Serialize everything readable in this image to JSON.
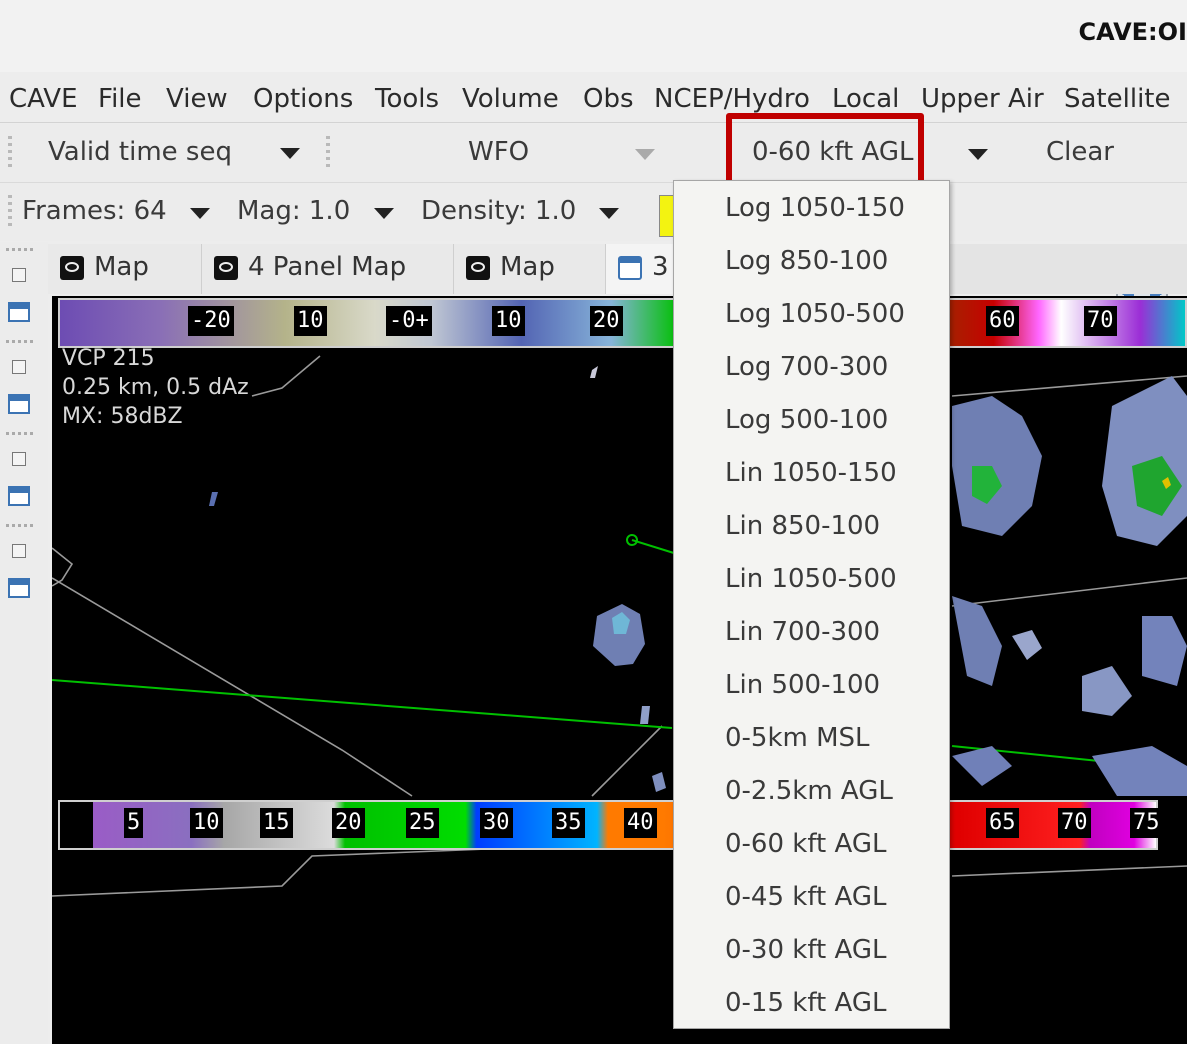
{
  "window": {
    "title": "CAVE:OI"
  },
  "menu": [
    "CAVE",
    "File",
    "View",
    "Options",
    "Tools",
    "Volume",
    "Obs",
    "NCEP/Hydro",
    "Local",
    "Upper Air",
    "Satellite"
  ],
  "toolbar": {
    "time_seq": "Valid time seq",
    "scale": "WFO",
    "height_selector": "0-60 kft AGL",
    "clear_label": "Clear",
    "frames": "Frames: 64",
    "mag": "Mag: 1.0",
    "density": "Density: 1.0"
  },
  "tabs": [
    {
      "label": "Map",
      "icon": "map-icon"
    },
    {
      "label": "4 Panel Map",
      "icon": "map-icon"
    },
    {
      "label": "Map",
      "icon": "map-icon"
    },
    {
      "label": "3",
      "icon": "window-icon"
    }
  ],
  "top_colorbar_labels": [
    "-20",
    "10",
    "-0+",
    "10",
    "20",
    "60",
    "70"
  ],
  "bottom_colorbar_labels": [
    "5",
    "10",
    "15",
    "20",
    "25",
    "30",
    "35",
    "40",
    "65",
    "70",
    "75"
  ],
  "radar_info": [
    "VCP 215",
    "0.25 km, 0.5 dAz",
    "MX: 58dBZ"
  ],
  "dropdown": {
    "items": [
      "Log 1050-150",
      "Log 850-100",
      "Log 1050-500",
      "Log 700-300",
      "Log 500-100",
      "Lin 1050-150",
      "Lin 850-100",
      "Lin 1050-500",
      "Lin 700-300",
      "Lin 500-100",
      "0-5km MSL",
      "0-2.5km AGL",
      "0-60 kft AGL",
      "0-45 kft AGL",
      "0-30 kft AGL",
      "0-15 kft AGL"
    ]
  },
  "colors": {
    "highlight": "#c00000",
    "map_background": "#000000"
  }
}
